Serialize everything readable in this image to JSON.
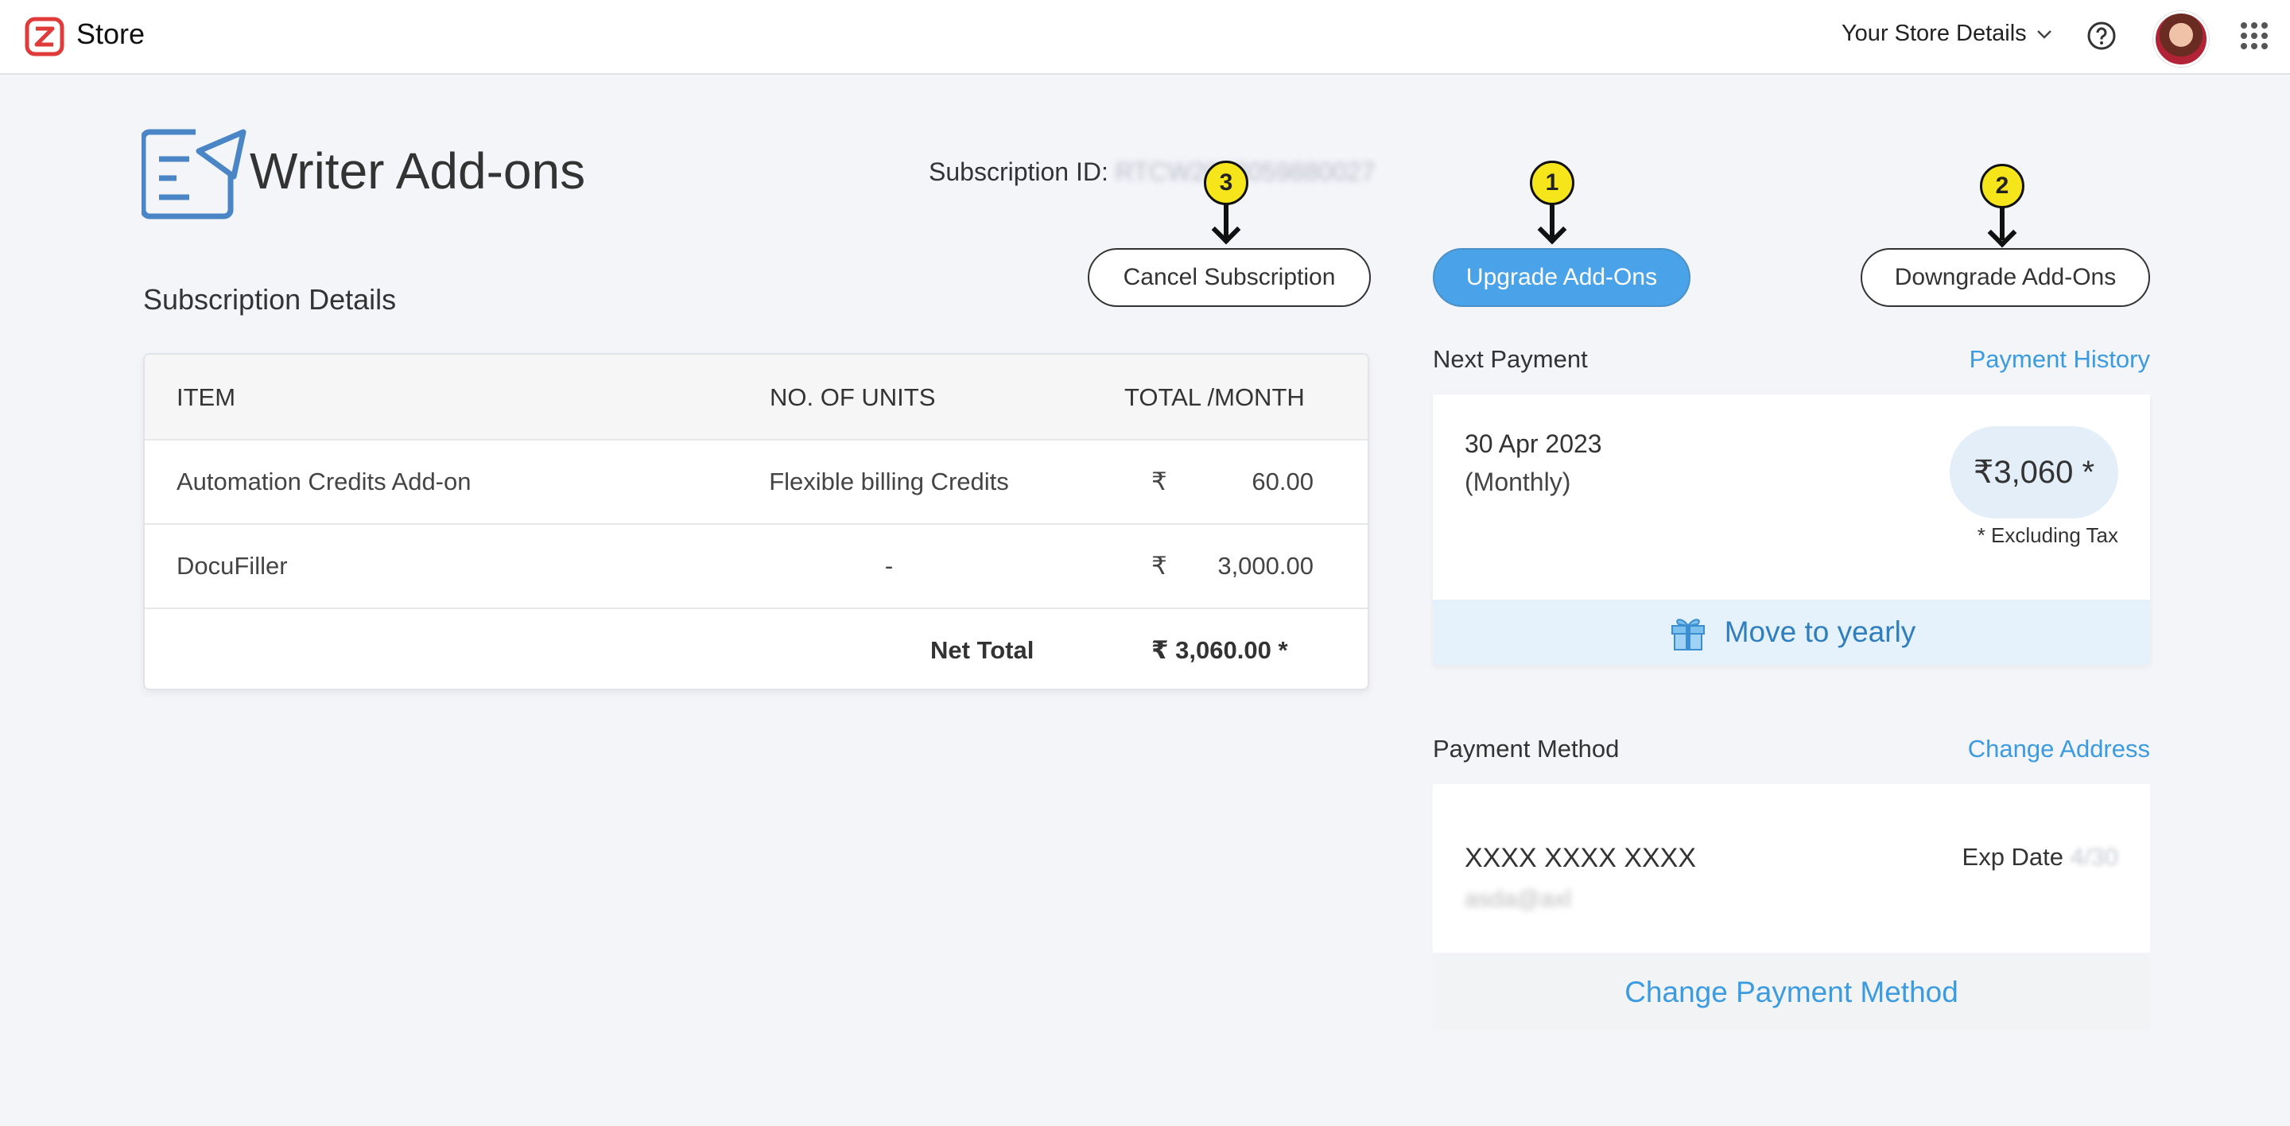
{
  "topbar": {
    "app_name": "Store",
    "store_details_label": "Your Store Details"
  },
  "header": {
    "title": "Writer Add-ons",
    "subscription_id_label": "Subscription ID:",
    "subscription_id_value": "RTCW2023059880027"
  },
  "actions": {
    "cancel_label": "Cancel Subscription",
    "upgrade_label": "Upgrade Add-Ons",
    "downgrade_label": "Downgrade Add-Ons"
  },
  "markers": {
    "cancel": "3",
    "upgrade": "1",
    "downgrade": "2"
  },
  "subscription": {
    "section_title": "Subscription Details",
    "columns": [
      "ITEM",
      "NO. OF UNITS",
      "TOTAL /MONTH"
    ],
    "rows": [
      {
        "item": "Automation Credits Add-on",
        "units": "Flexible billing Credits",
        "currency": "₹",
        "total": "60.00"
      },
      {
        "item": "DocuFiller",
        "units": "-",
        "currency": "₹",
        "total": "3,000.00"
      }
    ],
    "net_total_label": "Net Total",
    "net_total_value": "₹ 3,060.00 *"
  },
  "next_payment": {
    "label": "Next Payment",
    "history_link": "Payment History",
    "date": "30 Apr 2023",
    "frequency": "(Monthly)",
    "amount": "₹3,060 *",
    "tax_note": "* Excluding Tax",
    "move_yearly": "Move to yearly"
  },
  "payment_method": {
    "label": "Payment Method",
    "change_address_link": "Change Address",
    "card_number": "XXXX XXXX XXXX",
    "email": "asda@axl",
    "exp_label": "Exp Date",
    "exp_value": "4/30",
    "change_method": "Change Payment Method"
  },
  "icons": {
    "logo": "zoho-store-logo-icon",
    "chevron": "chevron-down-icon",
    "help": "help-icon",
    "apps": "apps-grid-icon",
    "writer": "writer-icon",
    "gift": "gift-icon"
  },
  "colors": {
    "accent": "#4aa3e8",
    "link": "#3b9be0",
    "marker": "#f7e51c",
    "logo": "#e03a3a"
  }
}
